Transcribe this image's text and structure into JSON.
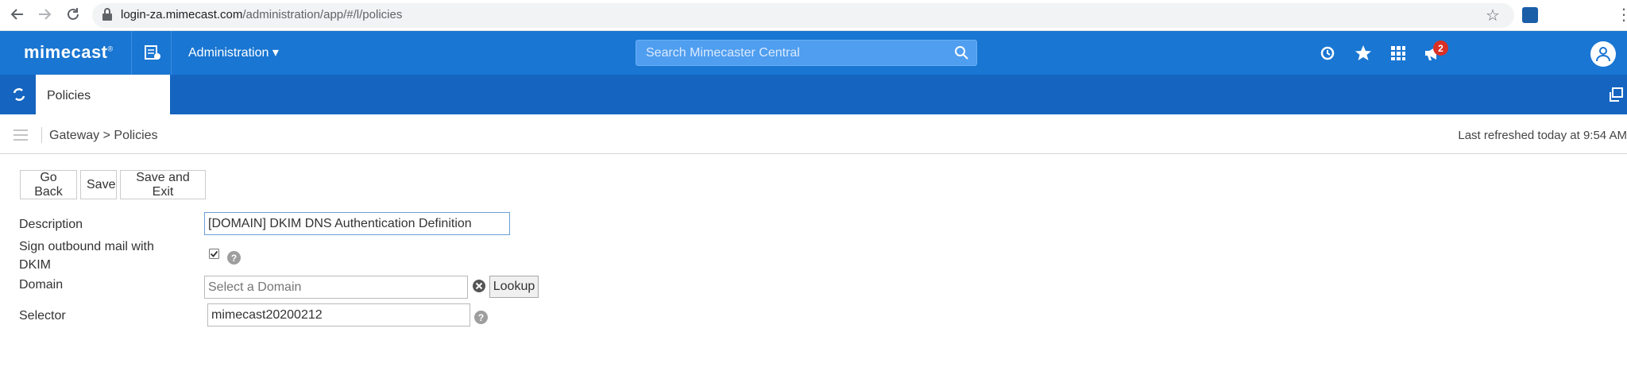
{
  "browser": {
    "url_host": "login-za.mimecast.com",
    "url_path": "/administration/app/#/l/policies"
  },
  "header": {
    "brand": "mimecast",
    "admin_menu": "Administration",
    "search_placeholder": "Search Mimecaster Central",
    "notification_count": "2"
  },
  "tabs": {
    "active": "Policies"
  },
  "breadcrumb": {
    "parent": "Gateway",
    "separator": ">",
    "current": "Policies",
    "refreshed": "Last refreshed today at 9:54 AM"
  },
  "toolbar": {
    "go_back": "Go Back",
    "save": "Save",
    "save_exit": "Save and Exit"
  },
  "form": {
    "description_label": "Description",
    "description_value": "[DOMAIN] DKIM DNS Authentication Definition",
    "sign_label_line1": "Sign outbound mail with",
    "sign_label_line2": "DKIM",
    "sign_checked": true,
    "domain_label": "Domain",
    "domain_placeholder": "Select a Domain",
    "lookup_label": "Lookup",
    "selector_label": "Selector",
    "selector_value": "mimecast20200212",
    "help_glyph": "?"
  },
  "icons": {
    "back": "arrow-left-icon",
    "forward": "arrow-right-icon",
    "reload": "reload-icon",
    "lock": "lock-icon",
    "bookmark": "star-outline-icon",
    "history": "history-icon",
    "favorites": "star-icon",
    "apps": "grid-icon",
    "notifications": "megaphone-icon",
    "user": "user-icon"
  },
  "colors": {
    "header_blue": "#1976d2",
    "tabbar_blue": "#1565c0",
    "search_blue": "#4f9ef0",
    "badge_red": "#d93025"
  }
}
